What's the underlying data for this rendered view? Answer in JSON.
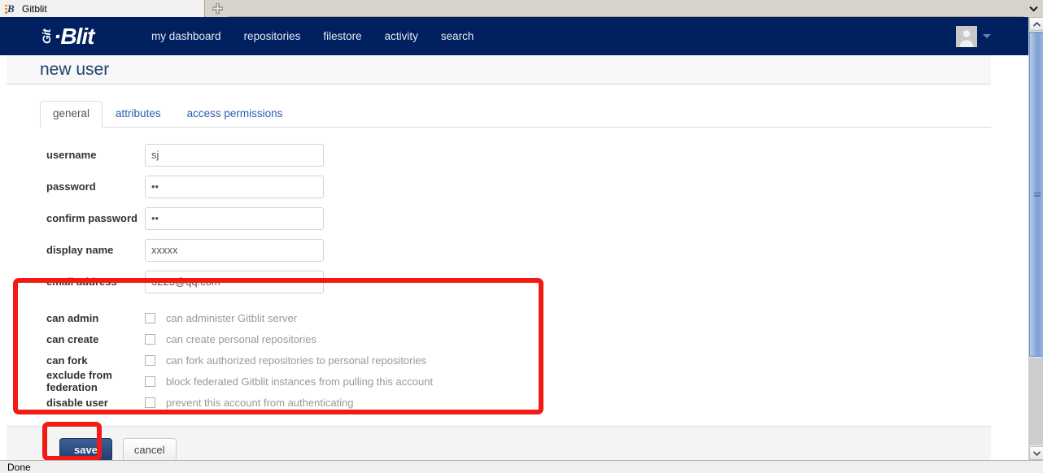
{
  "browser": {
    "tab_title": "Gitblit",
    "favicon_name": "gitblit-favicon",
    "new_tab_label": "+",
    "status_text": "Done"
  },
  "header": {
    "brand": {
      "git": "Git",
      "blit": "·Blit"
    },
    "nav_items": [
      {
        "label": "my dashboard",
        "name": "nav-my-dashboard"
      },
      {
        "label": "repositories",
        "name": "nav-repositories"
      },
      {
        "label": "filestore",
        "name": "nav-filestore"
      },
      {
        "label": "activity",
        "name": "nav-activity"
      },
      {
        "label": "search",
        "name": "nav-search"
      }
    ],
    "user_menu": {
      "avatar_name": "user-avatar",
      "caret_name": "chevron-down-icon"
    }
  },
  "page": {
    "title": "new user",
    "tabs": [
      {
        "label": "general",
        "active": true
      },
      {
        "label": "attributes",
        "active": false
      },
      {
        "label": "access permissions",
        "active": false
      }
    ]
  },
  "form": {
    "fields": [
      {
        "label": "username",
        "value": "sj",
        "placeholder": "",
        "type": "text",
        "name": "username"
      },
      {
        "label": "password",
        "value": "••",
        "placeholder": "",
        "type": "password",
        "name": "password"
      },
      {
        "label": "confirm password",
        "value": "••",
        "placeholder": "",
        "type": "password",
        "name": "confirm-password"
      },
      {
        "label": "display name",
        "value": "xxxxx",
        "placeholder": "",
        "type": "text",
        "name": "display-name"
      },
      {
        "label": "email address",
        "value": "3223@qq.com",
        "placeholder": "",
        "type": "text",
        "name": "email-address"
      }
    ],
    "permissions": [
      {
        "label": "can admin",
        "description": "can administer Gitblit server",
        "checked": false,
        "name": "can-admin"
      },
      {
        "label": "can create",
        "description": "can create personal repositories",
        "checked": false,
        "name": "can-create"
      },
      {
        "label": "can fork",
        "description": "can fork authorized repositories to personal repositories",
        "checked": false,
        "name": "can-fork"
      },
      {
        "label": "exclude from federation",
        "description": "block federated Gitblit instances from pulling this account",
        "checked": false,
        "name": "exclude-from-federation"
      },
      {
        "label": "disable user",
        "description": "prevent this account from authenticating",
        "checked": false,
        "name": "exclude-federation"
      }
    ],
    "buttons": {
      "save": "save",
      "cancel": "cancel"
    }
  },
  "annotations": {
    "color": "#f21a14",
    "boxes": [
      {
        "name": "permissions-highlight"
      },
      {
        "name": "save-highlight"
      }
    ]
  },
  "colors": {
    "header_navy": "#002060",
    "title_blue": "#20406e",
    "link_blue": "#2a5db0",
    "save_button": "#1f3c72",
    "annotation_red": "#f21a14"
  }
}
